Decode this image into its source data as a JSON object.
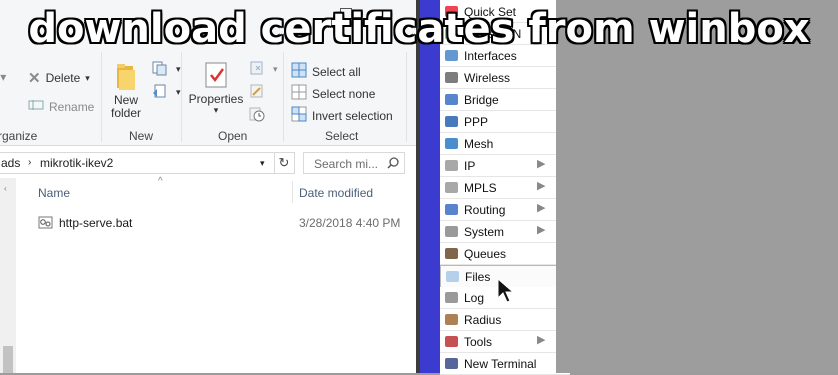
{
  "overlay_title": "download certificates from winbox",
  "explorer": {
    "ribbon": {
      "organize": {
        "label": "rganize",
        "delete_label": "Delete",
        "rename_label": "Rename"
      },
      "new": {
        "label": "New",
        "new_folder_label": "New\nfolder"
      },
      "open": {
        "label": "Open",
        "properties_label": "Properties"
      },
      "select": {
        "label": "Select",
        "select_all": "Select all",
        "select_none": "Select none",
        "invert_selection": "Invert selection"
      }
    },
    "address": {
      "crumb1": "ads",
      "crumb2": "mikrotik-ikev2",
      "search_placeholder": "Search mi..."
    },
    "columns": {
      "name": "Name",
      "date_modified": "Date modified"
    },
    "files": [
      {
        "name": "http-serve.bat",
        "date": "3/28/2018 4:40 PM"
      }
    ]
  },
  "winbox": {
    "items": [
      {
        "label": "Quick Set",
        "submenu": false
      },
      {
        "label": "CAPsMAN",
        "submenu": false
      },
      {
        "label": "Interfaces",
        "submenu": false
      },
      {
        "label": "Wireless",
        "submenu": false
      },
      {
        "label": "Bridge",
        "submenu": false
      },
      {
        "label": "PPP",
        "submenu": false
      },
      {
        "label": "Mesh",
        "submenu": false
      },
      {
        "label": "IP",
        "submenu": true
      },
      {
        "label": "MPLS",
        "submenu": true
      },
      {
        "label": "Routing",
        "submenu": true
      },
      {
        "label": "System",
        "submenu": true
      },
      {
        "label": "Queues",
        "submenu": false
      },
      {
        "label": "Files",
        "submenu": false
      },
      {
        "label": "Log",
        "submenu": false
      },
      {
        "label": "Radius",
        "submenu": false
      },
      {
        "label": "Tools",
        "submenu": true
      },
      {
        "label": "New Terminal",
        "submenu": false
      }
    ],
    "highlighted": "Files"
  }
}
